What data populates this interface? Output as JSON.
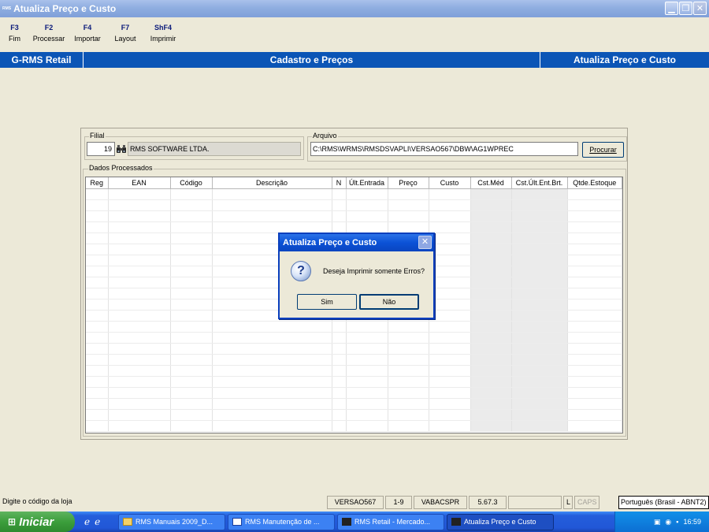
{
  "window": {
    "title": "Atualiza Preço e Custo",
    "icon_text": "RMS"
  },
  "toolbar": [
    {
      "key": "F3",
      "label": "Fim"
    },
    {
      "key": "F2",
      "label": "Processar"
    },
    {
      "key": "F4",
      "label": "Importar"
    },
    {
      "key": "F7",
      "label": "Layout"
    },
    {
      "key": "ShF4",
      "label": "Imprimir"
    }
  ],
  "band": {
    "left": "G-RMS Retail",
    "center": "Cadastro e Preços",
    "right": "Atualiza Preço e Custo"
  },
  "filial": {
    "label": "Filial",
    "number": "19",
    "name": "RMS SOFTWARE LTDA."
  },
  "arquivo": {
    "label": "Arquivo",
    "path": "C:\\RMS\\WRMS\\RMSDSVAPLI\\VERSAO567\\DBW\\AG1WPREC",
    "browse_label": "Procurar"
  },
  "dados": {
    "label": "Dados Processados",
    "columns": [
      "Reg",
      "EAN",
      "Código",
      "Descrição",
      "N",
      "Últ.Entrada",
      "Preço",
      "Custo",
      "Cst.Méd",
      "Cst.Últ.Ent.Brt.",
      "Qtde.Estoque"
    ]
  },
  "dialog": {
    "title": "Atualiza Preço e Custo",
    "message": "Deseja Imprimir somente Erros?",
    "yes": "Sim",
    "no": "Não"
  },
  "statusbar": {
    "hint": "Digite o código da loja",
    "version": "VERSAO567",
    "code": "1-9",
    "program": "VABACSPR",
    "build": "5.67.3",
    "l": "L",
    "caps": "CAPS",
    "language": "Português (Brasil - ABNT2)"
  },
  "taskbar": {
    "start": "Iniciar",
    "tasks": [
      "RMS Manuais 2009_D...",
      "RMS Manutenção de ...",
      "RMS Retail - Mercado...",
      "Atualiza Preço e Custo"
    ],
    "time": "16:59"
  }
}
